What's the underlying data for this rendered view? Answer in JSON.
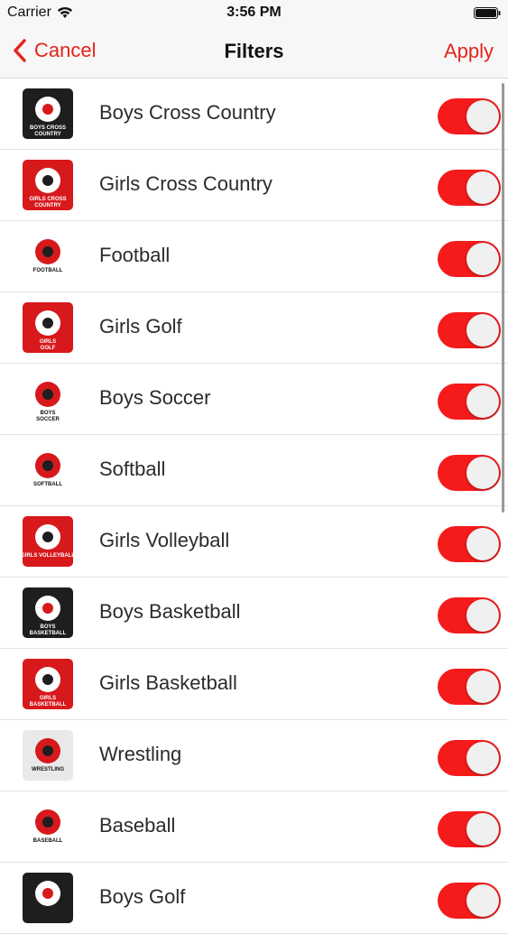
{
  "status_bar": {
    "carrier": "Carrier",
    "time": "3:56 PM"
  },
  "nav": {
    "cancel_label": "Cancel",
    "title": "Filters",
    "apply_label": "Apply"
  },
  "colors": {
    "accent": "#e5231b",
    "toggle_on": "#f51b1b"
  },
  "sports": [
    {
      "label": "Boys Cross Country",
      "icon": "boys-cross-country-icon",
      "icon_text": [
        "BOYS CROSS",
        "COUNTRY"
      ],
      "enabled": true
    },
    {
      "label": "Girls Cross Country",
      "icon": "girls-cross-country-icon",
      "icon_text": [
        "GIRLS CROSS",
        "COUNTRY"
      ],
      "enabled": true
    },
    {
      "label": "Football",
      "icon": "football-icon",
      "icon_text": [
        "FOOTBALL"
      ],
      "enabled": true
    },
    {
      "label": "Girls Golf",
      "icon": "girls-golf-icon",
      "icon_text": [
        "GIRLS",
        "GOLF"
      ],
      "enabled": true
    },
    {
      "label": "Boys Soccer",
      "icon": "boys-soccer-icon",
      "icon_text": [
        "BOYS",
        "SOCCER"
      ],
      "enabled": true
    },
    {
      "label": "Softball",
      "icon": "softball-icon",
      "icon_text": [
        "SOFTBALL"
      ],
      "enabled": true
    },
    {
      "label": "Girls Volleyball",
      "icon": "girls-volleyball-icon",
      "icon_text": [
        "GIRLS VOLLEYBALL"
      ],
      "enabled": true
    },
    {
      "label": "Boys Basketball",
      "icon": "boys-basketball-icon",
      "icon_text": [
        "BOYS",
        "BASKETBALL"
      ],
      "enabled": true
    },
    {
      "label": "Girls Basketball",
      "icon": "girls-basketball-icon",
      "icon_text": [
        "GIRLS",
        "BASKETBALL"
      ],
      "enabled": true
    },
    {
      "label": "Wrestling",
      "icon": "wrestling-icon",
      "icon_text": [
        "WRESTLING"
      ],
      "enabled": true
    },
    {
      "label": "Baseball",
      "icon": "baseball-icon",
      "icon_text": [
        "BASEBALL"
      ],
      "enabled": true
    },
    {
      "label": "Boys Golf",
      "icon": "boys-golf-icon",
      "icon_text": [],
      "enabled": true
    }
  ]
}
